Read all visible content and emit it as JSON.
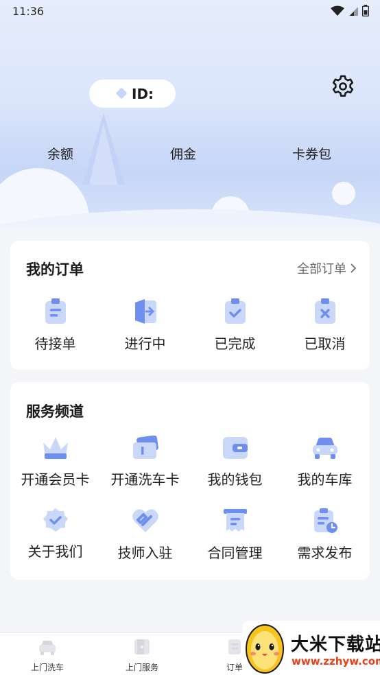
{
  "status_bar": {
    "time": "11:36"
  },
  "profile": {
    "id_label": "ID:"
  },
  "stats": [
    "余额",
    "佣金",
    "卡券包"
  ],
  "orders": {
    "title": "我的订单",
    "all_label": "全部订单",
    "items": [
      {
        "label": "待接单",
        "icon": "clipboard-icon"
      },
      {
        "label": "进行中",
        "icon": "door-arrow-icon"
      },
      {
        "label": "已完成",
        "icon": "clipboard-check-icon"
      },
      {
        "label": "已取消",
        "icon": "clipboard-x-icon"
      }
    ]
  },
  "services": {
    "title": "服务频道",
    "items": [
      {
        "label": "开通会员卡",
        "icon": "crown-icon"
      },
      {
        "label": "开通洗车卡",
        "icon": "card-icon"
      },
      {
        "label": "我的钱包",
        "icon": "wallet-icon"
      },
      {
        "label": "我的车库",
        "icon": "car-icon"
      },
      {
        "label": "关于我们",
        "icon": "badge-check-icon"
      },
      {
        "label": "技师入驻",
        "icon": "handshake-icon"
      },
      {
        "label": "合同管理",
        "icon": "contract-icon"
      },
      {
        "label": "需求发布",
        "icon": "publish-icon"
      }
    ]
  },
  "bottom_nav": [
    "上门洗车",
    "上门服务",
    "订单"
  ],
  "watermark": {
    "title": "大米下载站",
    "url": "www.zzhyw.com"
  },
  "colors": {
    "accent": "#6e8ff0",
    "accent_light": "#c9d7f9",
    "hero_top": "#e6edfb"
  }
}
